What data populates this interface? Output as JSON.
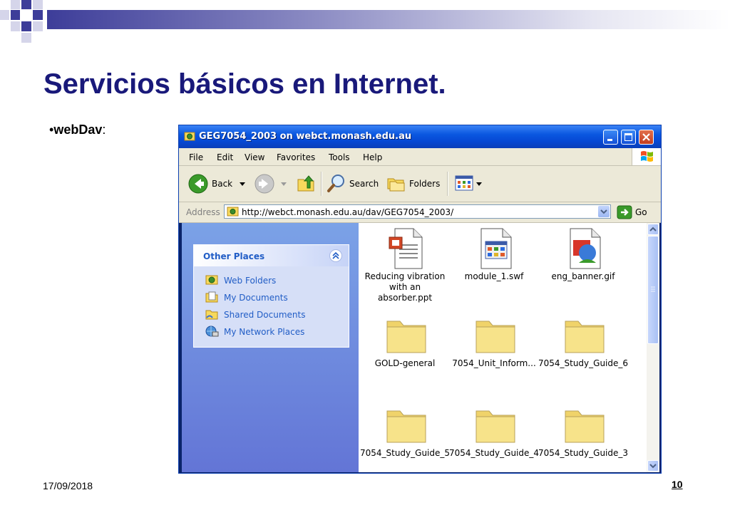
{
  "slide": {
    "title": "Servicios básicos en Internet.",
    "bullet_marker": "•",
    "bullet_text": "webDav",
    "bullet_suffix": ":",
    "date": "17/09/2018",
    "page_number": "10"
  },
  "colors": {
    "title": "#19197a",
    "xp_blue": "#0a57e0",
    "link_blue": "#215dc6",
    "folder_yellow": "#f7e38a"
  },
  "window": {
    "title": "GEG7054_2003 on webct.monash.edu.au",
    "controls": [
      "minimize-icon",
      "maximize-icon",
      "close-icon"
    ],
    "menu": [
      "File",
      "Edit",
      "View",
      "Favorites",
      "Tools",
      "Help"
    ],
    "toolbar": {
      "back": "Back",
      "search": "Search",
      "folders": "Folders"
    },
    "address": {
      "label": "Address",
      "value": "http://webct.monash.edu.au/dav/GEG7054_2003/",
      "go": "Go"
    },
    "other_places": {
      "title": "Other Places",
      "items": [
        "Web Folders",
        "My Documents",
        "Shared Documents",
        "My Network Places"
      ]
    },
    "files": [
      {
        "name": "Reducing vibration with an absorber.ppt",
        "lines": [
          "Reducing vibration",
          "with an",
          "absorber.ppt"
        ],
        "icon": "powerpoint-file-icon"
      },
      {
        "name": "module_1.swf",
        "lines": [
          "module_1.swf"
        ],
        "icon": "swf-file-icon"
      },
      {
        "name": "eng_banner.gif",
        "lines": [
          "eng_banner.gif"
        ],
        "icon": "gif-file-icon"
      },
      {
        "name": "GOLD-general",
        "lines": [
          "GOLD-general"
        ],
        "icon": "folder-icon"
      },
      {
        "name": "7054_Unit_Inform...",
        "lines": [
          "7054_Unit_Inform..."
        ],
        "icon": "folder-icon"
      },
      {
        "name": "7054_Study_Guide_6",
        "lines": [
          "7054_Study_Guide_6"
        ],
        "icon": "folder-icon"
      },
      {
        "name": "7054_Study_Guide_5",
        "lines": [
          "7054_Study_Guide_5"
        ],
        "icon": "folder-icon"
      },
      {
        "name": "7054_Study_Guide_4",
        "lines": [
          "7054_Study_Guide_4"
        ],
        "icon": "folder-icon"
      },
      {
        "name": "7054_Study_Guide_3",
        "lines": [
          "7054_Study_Guide_3"
        ],
        "icon": "folder-icon"
      }
    ]
  }
}
